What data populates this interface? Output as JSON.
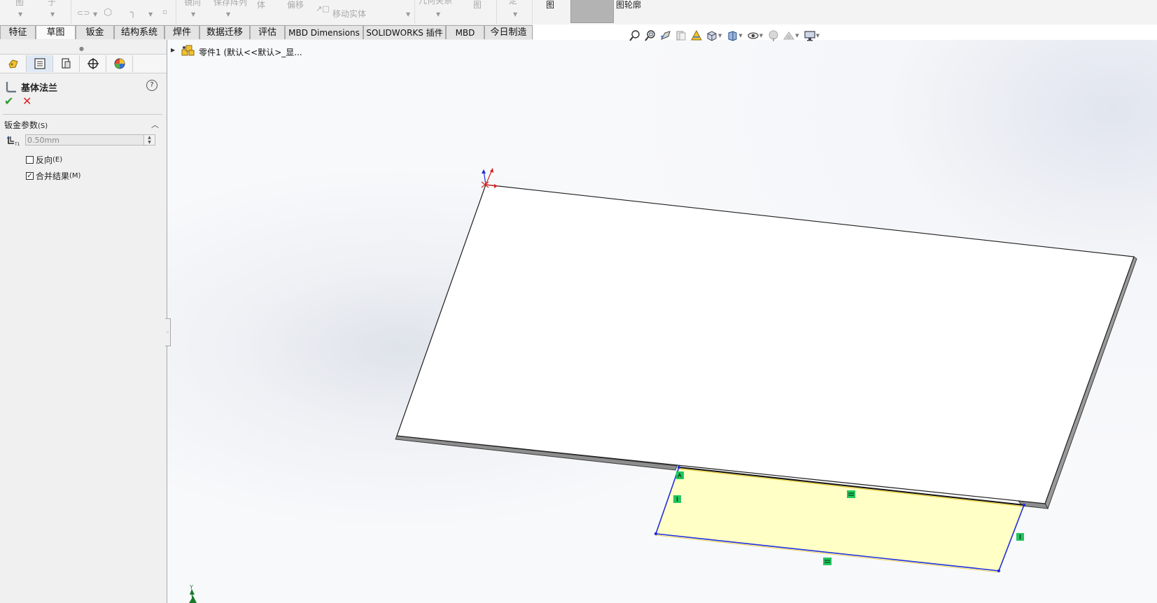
{
  "ribbon": {
    "move_entity_label": "移动实体",
    "body_label": "体",
    "offset_label": "偏移",
    "geometry_relation_label": "几何关系",
    "view_label": "图",
    "view2_label": "图",
    "profile_label": "图轮廓",
    "fragment_a": "图",
    "fragment_b": "于",
    "fragment_c": "镜向",
    "fragment_d": "保存阵列",
    "fragment_e": "定"
  },
  "tabs": [
    {
      "label": "特征"
    },
    {
      "label": "草图"
    },
    {
      "label": "钣金"
    },
    {
      "label": "结构系统"
    },
    {
      "label": "焊件"
    },
    {
      "label": "数据迁移"
    },
    {
      "label": "评估"
    },
    {
      "label": "MBD Dimensions"
    },
    {
      "label": "SOLIDWORKS 插件"
    },
    {
      "label": "MBD"
    },
    {
      "label": "今日制造"
    }
  ],
  "active_tab": "草图",
  "property_manager": {
    "title": "基体法兰",
    "help_symbol": "?",
    "ok_symbol": "✔",
    "cancel_symbol": "✕",
    "section_title": "钣金参数",
    "section_hotkey": "(S)",
    "thickness_value": "0.50mm",
    "reverse_label": "反向",
    "reverse_hotkey": "(E)",
    "reverse_checked": false,
    "merge_label": "合并结果",
    "merge_hotkey": "(M)",
    "merge_checked": true
  },
  "tree": {
    "part_label": "零件1  (默认<<默认>_显..."
  },
  "colors": {
    "sketch_fill": "#ffffc6",
    "sketch_line": "#1f2fd8",
    "relation_marker": "#22c55e",
    "ok_green": "#2b9a2b",
    "cancel_red": "#dd2222"
  },
  "headsup_icons": [
    "zoom-to-fit-icon",
    "zoom-area-icon",
    "previous-view-icon",
    "section-view-icon",
    "dynamic-annotation-icon",
    "view-orientation-icon",
    "display-style-icon",
    "hide-show-icon",
    "edit-appearance-icon",
    "apply-scene-icon",
    "view-settings-icon"
  ],
  "triad_label": "Y"
}
